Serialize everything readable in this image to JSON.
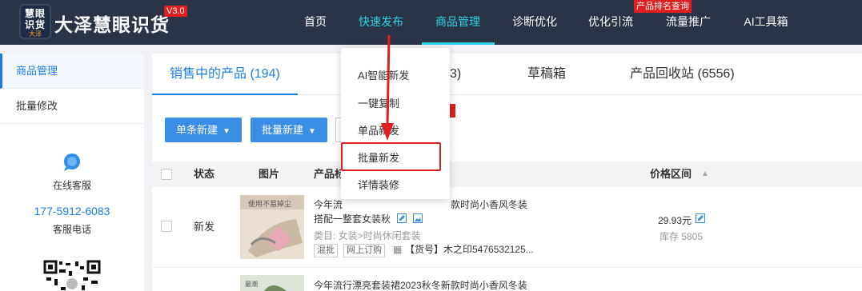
{
  "header": {
    "logo_line1": "慧眼",
    "logo_line2": "识货",
    "logo_sub": "大泽",
    "brand": "大泽慧眼识货",
    "version": "V3.0",
    "nav": [
      {
        "label": "首页"
      },
      {
        "label": "快速发布"
      },
      {
        "label": "商品管理"
      },
      {
        "label": "诊断优化"
      },
      {
        "label": "优化引流"
      },
      {
        "label": "流量推广"
      },
      {
        "label": "AI工具箱"
      }
    ],
    "nav_badge": "产品排名查询"
  },
  "sidebar": {
    "items": [
      {
        "label": "商品管理"
      },
      {
        "label": "批量修改"
      }
    ],
    "service_label": "在线客服",
    "phone": "177-5912-6083",
    "phone_label": "客服电话"
  },
  "main": {
    "tabs": [
      {
        "label": "销售中的产品 (194)"
      },
      {
        "label": "3)"
      },
      {
        "label": "草稿箱"
      },
      {
        "label": "产品回收站 (6556)"
      }
    ],
    "buttons": [
      {
        "label": "单条新建"
      },
      {
        "label": "批量新建"
      }
    ],
    "table_headers": {
      "status": "状态",
      "image": "图片",
      "product": "产品标",
      "price_range": "价格区间"
    },
    "rows": [
      {
        "status": "新发",
        "thumb_caption": "使用不易掉尘",
        "title_line1": "今年流",
        "title_line1_tail": "款时尚小香风冬装",
        "title_line2": "搭配一整套女装秋",
        "category": "类目: 女装>时尚休闲套装",
        "tags": [
          "混批",
          "网上订购"
        ],
        "sku": "【货号】木之印5476532125...",
        "price": "29.93元",
        "stock": "库存 5805"
      },
      {
        "thumb_caption": "最潮",
        "title_line1": "今年流行漂亮套装裙2023秋冬新款时尚小香风冬装"
      }
    ]
  },
  "dropdown": {
    "items": [
      {
        "label": "AI智能新发"
      },
      {
        "label": "一键复制"
      },
      {
        "label": "单品新发"
      },
      {
        "label": "批量新发"
      },
      {
        "label": "详情装修"
      }
    ]
  },
  "colors": {
    "topbar": "#2b3346",
    "accent": "#1a7ee6",
    "nav_active": "#2dd4e8",
    "highlight": "#e02020"
  }
}
